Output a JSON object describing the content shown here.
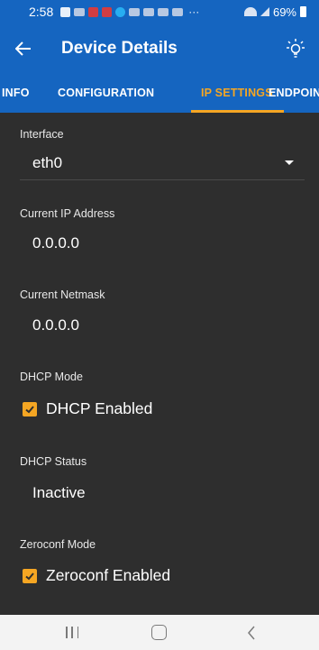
{
  "status_bar": {
    "time": "2:58",
    "dots": "···",
    "battery_percent": "69%",
    "icons": [
      "notification-icon",
      "cast-icon",
      "p-app-icon",
      "p-app-icon-2",
      "messenger-icon",
      "app-icon-1",
      "app-icon-2",
      "app-icon-3",
      "app-icon-4",
      "wifi-icon",
      "signal-icon",
      "battery-icon"
    ]
  },
  "app_bar": {
    "title": "Device Details",
    "back_icon": "arrow-back-icon",
    "action_icon": "lightbulb-icon"
  },
  "tabs": [
    {
      "label": "INFO",
      "active": false
    },
    {
      "label": "CONFIGURATION",
      "active": false
    },
    {
      "label": "IP SETTINGS",
      "active": true
    },
    {
      "label": "ENDPOIN",
      "active": false
    }
  ],
  "fields": {
    "interface": {
      "label": "Interface",
      "value": "eth0"
    },
    "current_ip": {
      "label": "Current IP Address",
      "value": "0.0.0.0"
    },
    "current_netmask": {
      "label": "Current Netmask",
      "value": "0.0.0.0"
    },
    "dhcp_mode": {
      "label": "DHCP Mode",
      "checkbox_label": "DHCP Enabled",
      "checked": true
    },
    "dhcp_status": {
      "label": "DHCP Status",
      "value": "Inactive"
    },
    "zeroconf_mode": {
      "label": "Zeroconf Mode",
      "checkbox_label": "Zeroconf Enabled",
      "checked": true
    }
  },
  "colors": {
    "primary": "#1565c0",
    "accent": "#f5a623",
    "background": "#2e2e2e",
    "nav_bar": "#f3f3f3"
  },
  "nav_bar": {
    "icons": [
      "recent-apps-icon",
      "home-icon",
      "back-icon"
    ]
  }
}
